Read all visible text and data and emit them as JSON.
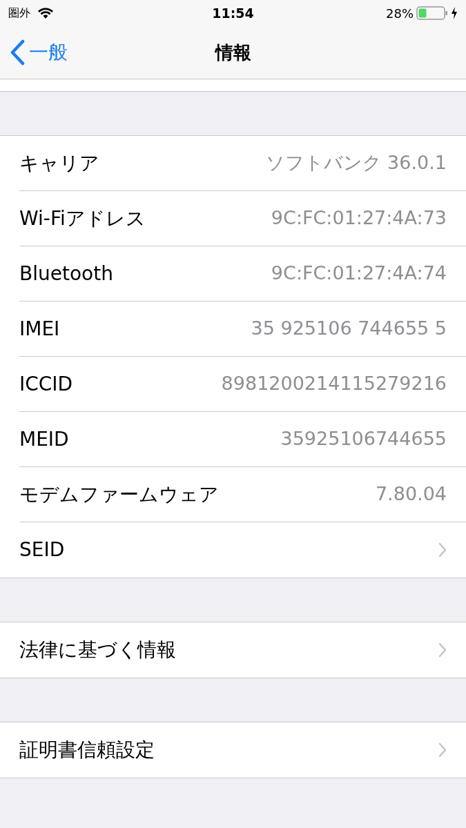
{
  "status_bar": {
    "carrier": "圏外",
    "time": "11:54",
    "battery": "28%"
  },
  "nav": {
    "back": "一般",
    "title": "情報"
  },
  "groups": [
    {
      "rows": [
        {
          "kind": "value",
          "label": "キャリア",
          "value": "ソフトバンク 36.0.1"
        },
        {
          "kind": "value",
          "label": "Wi-Fiアドレス",
          "value": "9C:FC:01:27:4A:73"
        },
        {
          "kind": "value",
          "label": "Bluetooth",
          "value": "9C:FC:01:27:4A:74"
        },
        {
          "kind": "value",
          "label": "IMEI",
          "value": "35 925106 744655 5"
        },
        {
          "kind": "value",
          "label": "ICCID",
          "value": "8981200214115279216"
        },
        {
          "kind": "value",
          "label": "MEID",
          "value": "35925106744655"
        },
        {
          "kind": "value",
          "label": "モデムファームウェア",
          "value": "7.80.04"
        },
        {
          "kind": "disclosure",
          "label": "SEID"
        }
      ]
    },
    {
      "rows": [
        {
          "kind": "disclosure",
          "label": "法律に基づく情報"
        }
      ]
    },
    {
      "rows": [
        {
          "kind": "disclosure",
          "label": "証明書信頼設定"
        }
      ]
    }
  ]
}
